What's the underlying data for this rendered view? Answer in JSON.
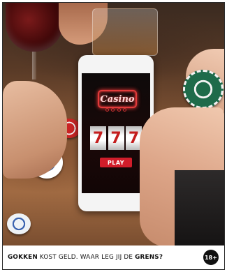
{
  "ad": {
    "footer": {
      "slogan_part1": "GOKKEN",
      "slogan_part2": " KOST GELD. WAAR LEG JIJ DE ",
      "slogan_part3": "GRENS",
      "slogan_part4": "?",
      "age_badge": "18+"
    },
    "phone_screen": {
      "logo_text": "Casino",
      "reels": [
        "7",
        "7",
        "7"
      ],
      "play_label": "PLAY"
    }
  },
  "colors": {
    "accent_red": "#d11d2a",
    "neon_red": "#e23b3b",
    "footer_bg": "#ffffff",
    "badge_bg": "#111111"
  }
}
